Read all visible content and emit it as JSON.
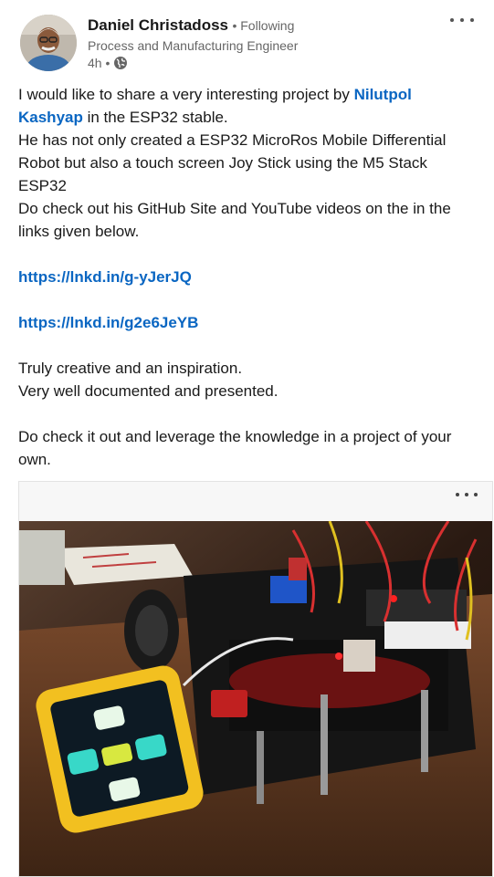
{
  "post": {
    "author": {
      "name": "Daniel Christadoss",
      "follow_status": "• Following",
      "headline": "Process and Manufacturing Engineer",
      "time": "4h •"
    },
    "icons": {
      "visibility": "globe-icon",
      "menu": "more-options-icon"
    },
    "body": {
      "p1_before": "I would like to share a very interesting project by ",
      "p1_mention": "Nilutpol Kashyap",
      "p1_after": " in the ESP32 stable.",
      "p2": "He has not only created a ESP32 MicroRos Mobile Differential Robot but also a touch screen Joy Stick using the M5 Stack ESP32",
      "p3": "Do check out his GitHub Site and YouTube videos on the in the links given below.",
      "link1": "https://lnkd.in/g-yJerJQ",
      "link2": "https://lnkd.in/g2e6JeYB",
      "p4": "Truly creative and an inspiration.",
      "p5": "Very well documented and presented.",
      "p6": "Do check it out and leverage the knowledge in a project of your own."
    },
    "media": {
      "menu_icon": "more-options-icon"
    },
    "colors": {
      "link": "#0a66c2",
      "text": "#191919",
      "muted": "#666666"
    }
  }
}
